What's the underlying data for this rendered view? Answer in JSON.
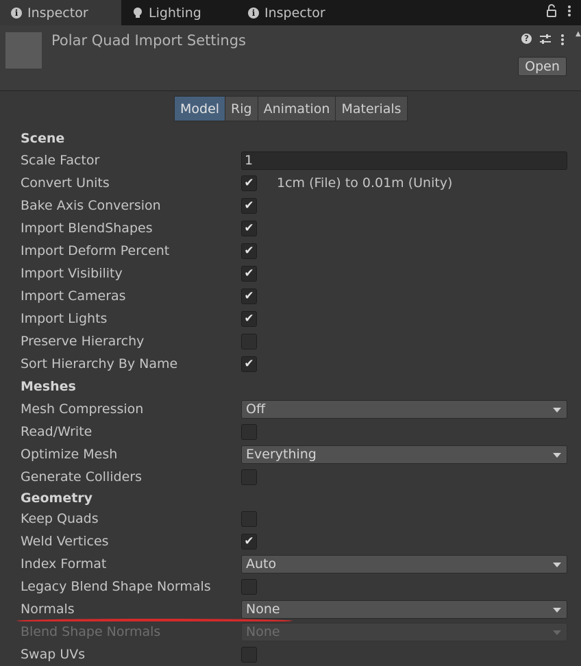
{
  "window_tabs": [
    {
      "label": "Inspector",
      "icon": "info-icon",
      "active": true
    },
    {
      "label": "Lighting",
      "icon": "lightbulb-icon",
      "active": false
    },
    {
      "label": "Inspector",
      "icon": "info-icon",
      "active": false
    }
  ],
  "header": {
    "title": "Polar Quad Import Settings",
    "open_label": "Open",
    "help_glyph": "?"
  },
  "section_tabs": [
    "Model",
    "Rig",
    "Animation",
    "Materials"
  ],
  "scene": {
    "heading": "Scene",
    "scale_factor_label": "Scale Factor",
    "scale_factor_value": "1",
    "convert_units_label": "Convert Units",
    "convert_units_note": "1cm (File) to 0.01m (Unity)",
    "bake_axis_label": "Bake Axis Conversion",
    "import_blendshapes_label": "Import BlendShapes",
    "import_deform_label": "Import Deform Percent",
    "import_visibility_label": "Import Visibility",
    "import_cameras_label": "Import Cameras",
    "import_lights_label": "Import Lights",
    "preserve_hierarchy_label": "Preserve Hierarchy",
    "sort_hierarchy_label": "Sort Hierarchy By Name"
  },
  "meshes": {
    "heading": "Meshes",
    "mesh_compression_label": "Mesh Compression",
    "mesh_compression_value": "Off",
    "read_write_label": "Read/Write",
    "optimize_mesh_label": "Optimize Mesh",
    "optimize_mesh_value": "Everything",
    "generate_colliders_label": "Generate Colliders"
  },
  "geometry": {
    "heading": "Geometry",
    "keep_quads_label": "Keep Quads",
    "weld_vertices_label": "Weld Vertices",
    "index_format_label": "Index Format",
    "index_format_value": "Auto",
    "legacy_blend_label": "Legacy Blend Shape Normals",
    "normals_label": "Normals",
    "normals_value": "None",
    "blend_shape_normals_label": "Blend Shape Normals",
    "blend_shape_normals_value": "None",
    "swap_uvs_label": "Swap UVs"
  },
  "checkboxes": {
    "convert_units": true,
    "bake_axis": true,
    "import_blendshapes": true,
    "import_deform": true,
    "import_visibility": true,
    "import_cameras": true,
    "import_lights": true,
    "preserve_hierarchy": false,
    "sort_hierarchy": true,
    "read_write": false,
    "generate_colliders": false,
    "keep_quads": false,
    "weld_vertices": true,
    "legacy_blend": false,
    "swap_uvs": false
  },
  "colors": {
    "background": "#383838",
    "tab_strip": "#191919",
    "active_section_tab": "#46607c",
    "annotation_underline": "#d42a2a"
  }
}
